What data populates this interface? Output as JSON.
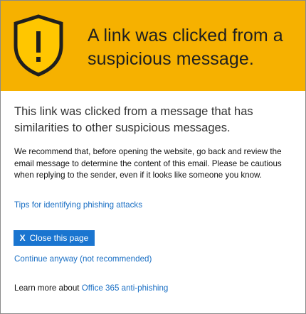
{
  "banner": {
    "icon": "warning-shield-icon",
    "background_color": "#f6b100",
    "title": "A link was clicked from a suspicious message."
  },
  "main": {
    "subtitle": "This link was clicked from a message that has similarities to other suspicious messages.",
    "body": "We recommend that, before opening the website, go back and review the email message to determine the content of this email. Please be cautious when replying to the sender, even if it looks like someone you know.",
    "tips_link": "Tips for identifying phishing attacks",
    "close_button": {
      "icon": "X",
      "label": "Close this page",
      "color": "#1a75d0"
    },
    "continue_link": "Continue anyway (not recommended)",
    "learn_more_prefix": "Learn more about",
    "learn_more_link": "Office 365 anti-phishing"
  },
  "link_color": "#1a6fc4"
}
